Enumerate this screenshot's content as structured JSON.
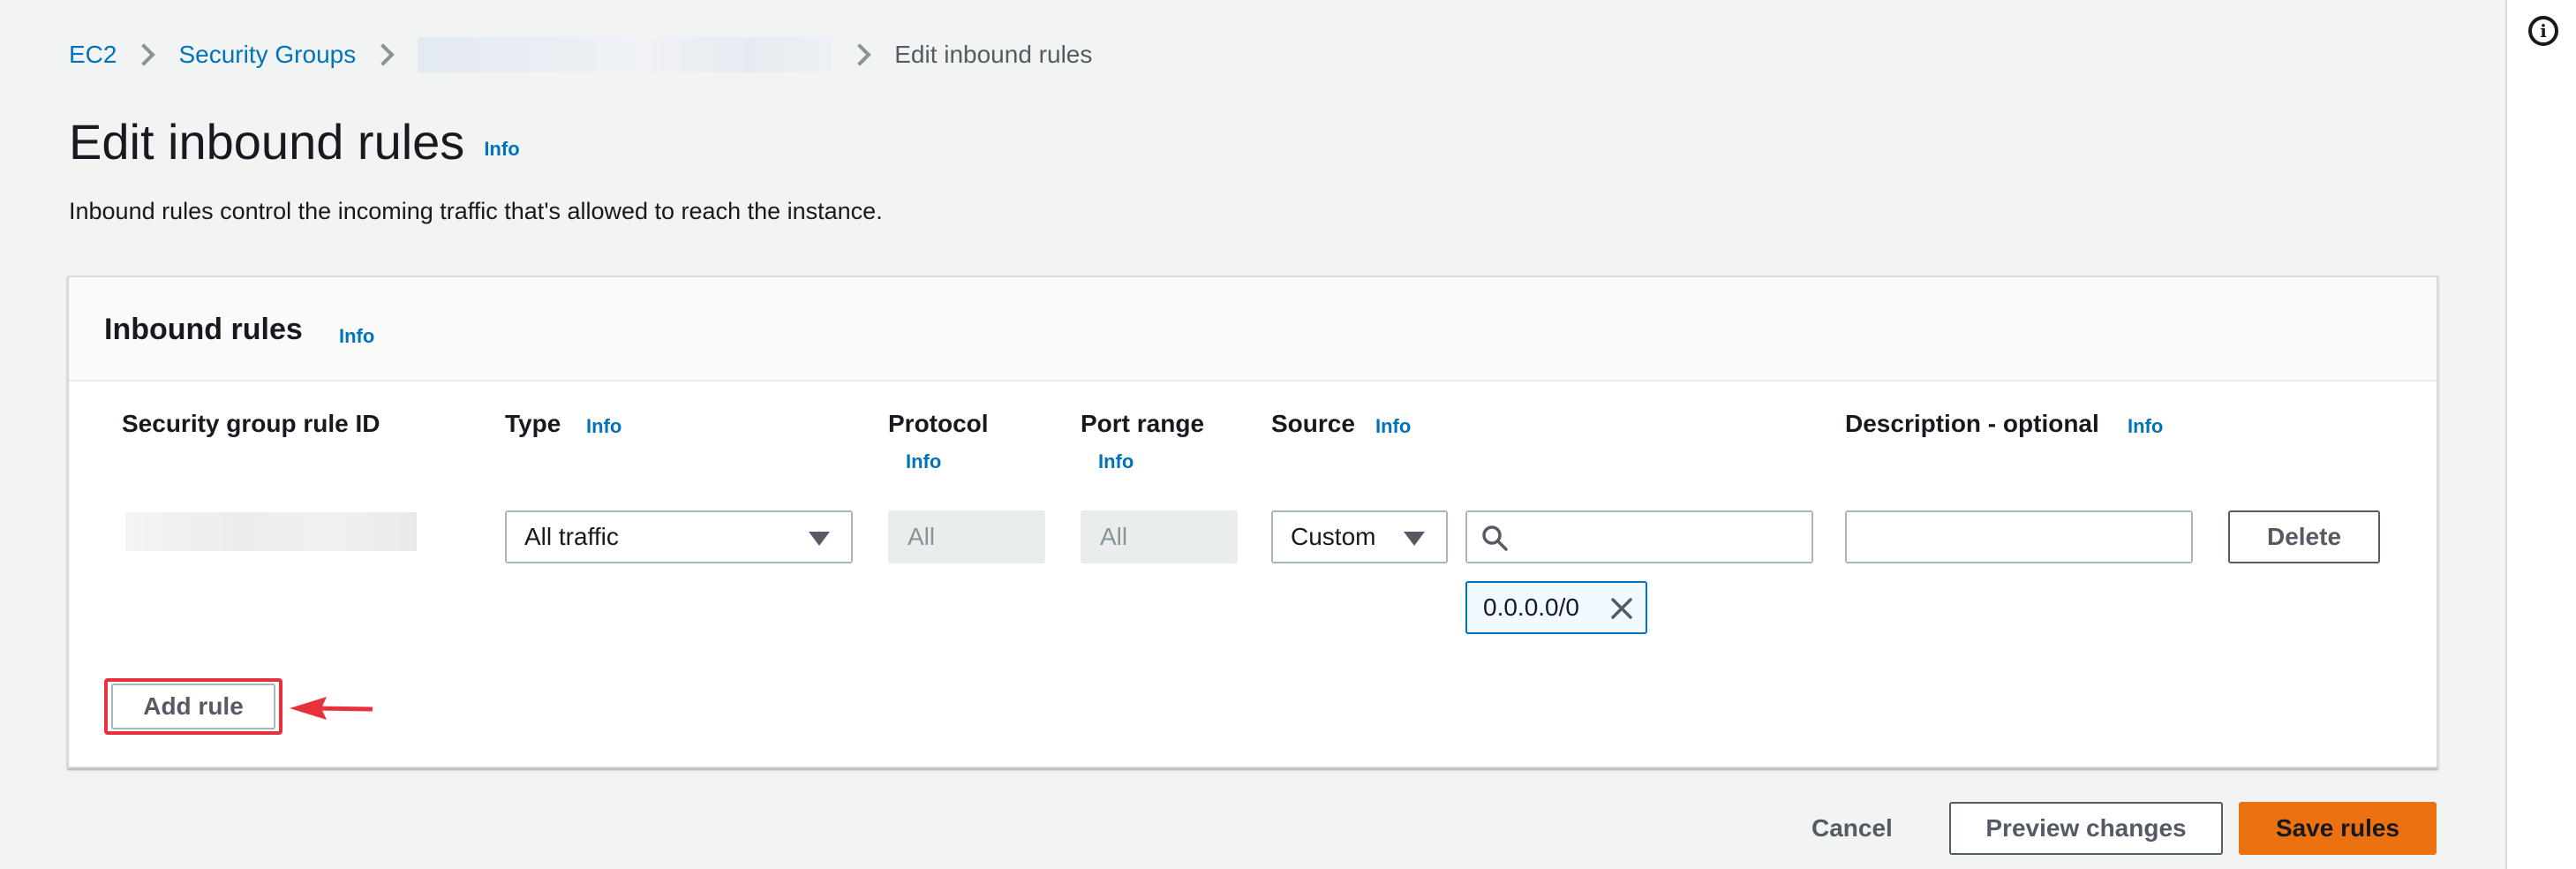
{
  "breadcrumb": {
    "items": [
      "EC2",
      "Security Groups"
    ],
    "current": "Edit inbound rules"
  },
  "page": {
    "title": "Edit inbound rules",
    "info": "Info",
    "description": "Inbound rules control the incoming traffic that's allowed to reach the instance."
  },
  "panel": {
    "title": "Inbound rules",
    "info": "Info",
    "columns": {
      "rule_id": "Security group rule ID",
      "type": "Type",
      "protocol": "Protocol",
      "port_range": "Port range",
      "source": "Source",
      "description": "Description - optional"
    },
    "info_label": "Info"
  },
  "rule": {
    "type": "All traffic",
    "protocol": "All",
    "port_range": "All",
    "source_type": "Custom",
    "source_search_value": "",
    "source_token": "0.0.0.0/0",
    "description_value": "",
    "delete_label": "Delete"
  },
  "actions": {
    "add_rule": "Add rule",
    "cancel": "Cancel",
    "preview": "Preview changes",
    "save": "Save rules"
  },
  "icons": {
    "chevron": "chevron-right-icon",
    "caret": "caret-down-icon",
    "search": "search-icon",
    "close": "close-icon",
    "info": "info-circle-icon",
    "annotation": "red-arrow-icon"
  },
  "colors": {
    "link": "#0073bb",
    "primary": "#ec7211",
    "highlight": "#e8313b",
    "token_border": "#0073bb"
  }
}
